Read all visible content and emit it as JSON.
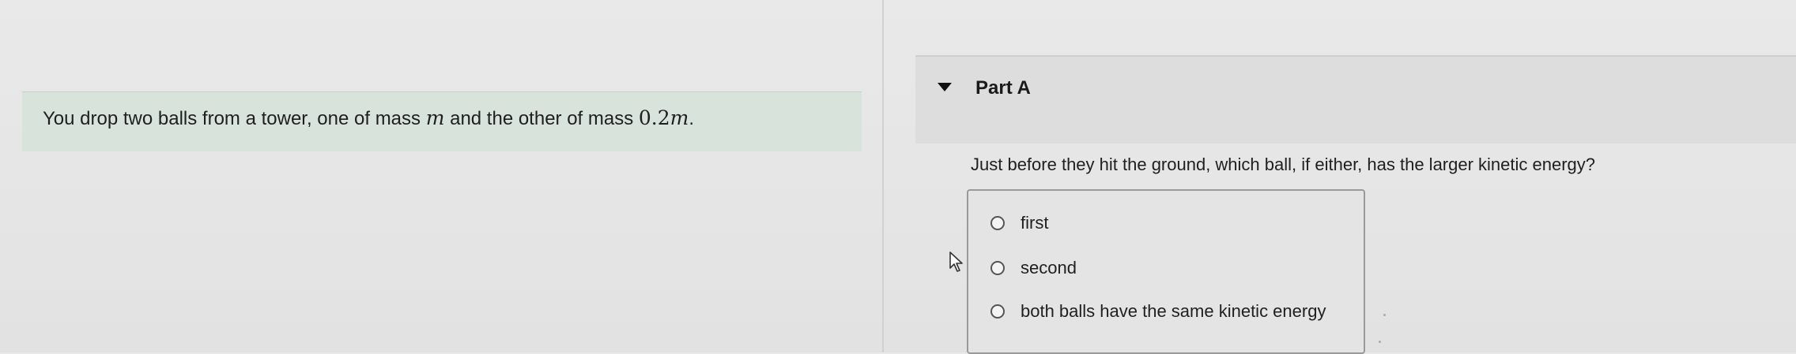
{
  "intro": {
    "text_before": "You drop two balls from a tower, one of mass ",
    "mass_symbol": "m",
    "text_middle": " and the other of mass ",
    "mass2_number": "0.2",
    "mass2_symbol": "m",
    "text_end": "."
  },
  "part": {
    "title": "Part A",
    "toggle_icon": "triangle-down-icon"
  },
  "question": "Just before they hit the ground, which ball, if either, has the larger kinetic energy?",
  "options": [
    {
      "label": "first",
      "selected": false
    },
    {
      "label": "second",
      "selected": false
    },
    {
      "label": "both balls have the same kinetic energy",
      "selected": false
    }
  ],
  "cursor_icon": "pointer-cursor-icon"
}
